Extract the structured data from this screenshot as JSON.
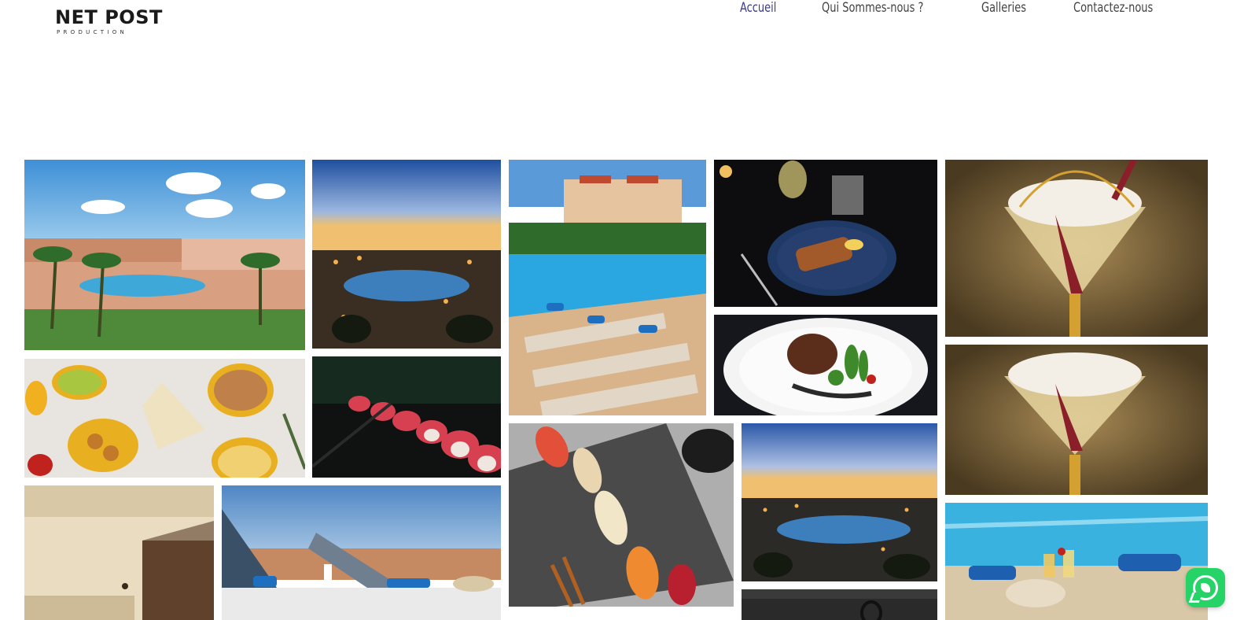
{
  "header": {
    "logo_text": "NET POST",
    "logo_sub": "PRODUCTION",
    "nav": [
      {
        "label": "Accueil",
        "active": true
      },
      {
        "label": "Qui Sommes-nous ?",
        "active": false
      },
      {
        "label": "Galleries",
        "active": false
      },
      {
        "label": "Contactez-nous",
        "active": false
      }
    ]
  },
  "gallery": {
    "photos": [
      {
        "name": "photo-resort-pool-day",
        "subject": "resort pool with palm trees, daytime"
      },
      {
        "name": "photo-resort-night-aerial",
        "subject": "resort at dusk, aerial view"
      },
      {
        "name": "photo-pool-loungers",
        "subject": "pool with loungers and towels"
      },
      {
        "name": "photo-plated-dish-dark",
        "subject": "plated dish on dark table with glasses"
      },
      {
        "name": "photo-dessert-cocktail",
        "subject": "dessert cup with whipped cream"
      },
      {
        "name": "photo-tapas-spread",
        "subject": "tapas spread in yellow bowls"
      },
      {
        "name": "photo-sushi-rolls",
        "subject": "sushi rolls close-up"
      },
      {
        "name": "photo-steak-plate",
        "subject": "steak with vegetables on white plate"
      },
      {
        "name": "photo-dessert-cocktail-2",
        "subject": "dessert cup with whipped cream"
      },
      {
        "name": "photo-hotel-room",
        "subject": "hotel room interior"
      },
      {
        "name": "photo-beach-loungers",
        "subject": "beach loungers with towels"
      },
      {
        "name": "photo-sushi-slate",
        "subject": "sushi pieces on slate with chopsticks"
      },
      {
        "name": "photo-resort-night-aerial-2",
        "subject": "resort at dusk, aerial view"
      },
      {
        "name": "photo-poolside-drinks",
        "subject": "poolside drinks and towels"
      },
      {
        "name": "photo-object-dark",
        "subject": "dark object, partially visible"
      }
    ]
  },
  "whatsapp": {
    "icon": "whatsapp-icon",
    "color": "#25d366"
  }
}
